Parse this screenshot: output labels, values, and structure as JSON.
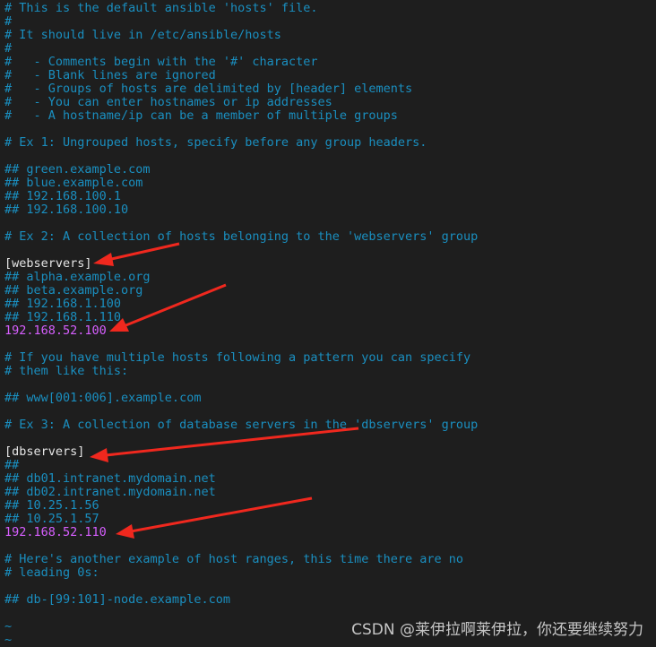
{
  "editor": {
    "lines": [
      {
        "text": "# This is the default ansible 'hosts' file.",
        "type": "comment"
      },
      {
        "text": "#",
        "type": "comment"
      },
      {
        "text": "# It should live in /etc/ansible/hosts",
        "type": "comment"
      },
      {
        "text": "#",
        "type": "comment"
      },
      {
        "text": "#   - Comments begin with the '#' character",
        "type": "comment"
      },
      {
        "text": "#   - Blank lines are ignored",
        "type": "comment"
      },
      {
        "text": "#   - Groups of hosts are delimited by [header] elements",
        "type": "comment"
      },
      {
        "text": "#   - You can enter hostnames or ip addresses",
        "type": "comment"
      },
      {
        "text": "#   - A hostname/ip can be a member of multiple groups",
        "type": "comment"
      },
      {
        "text": "",
        "type": "blank"
      },
      {
        "text": "# Ex 1: Ungrouped hosts, specify before any group headers.",
        "type": "comment"
      },
      {
        "text": "",
        "type": "blank"
      },
      {
        "text": "## green.example.com",
        "type": "comment"
      },
      {
        "text": "## blue.example.com",
        "type": "comment"
      },
      {
        "text": "## 192.168.100.1",
        "type": "comment"
      },
      {
        "text": "## 192.168.100.10",
        "type": "comment"
      },
      {
        "text": "",
        "type": "blank"
      },
      {
        "text": "# Ex 2: A collection of hosts belonging to the 'webservers' group",
        "type": "comment"
      },
      {
        "text": "",
        "type": "blank"
      },
      {
        "text": "[webservers]",
        "type": "header"
      },
      {
        "text": "## alpha.example.org",
        "type": "comment"
      },
      {
        "text": "## beta.example.org",
        "type": "comment"
      },
      {
        "text": "## 192.168.1.100",
        "type": "comment"
      },
      {
        "text": "## 192.168.1.110",
        "type": "comment"
      },
      {
        "text": "192.168.52.100",
        "type": "host"
      },
      {
        "text": "",
        "type": "blank"
      },
      {
        "text": "# If you have multiple hosts following a pattern you can specify",
        "type": "comment"
      },
      {
        "text": "# them like this:",
        "type": "comment"
      },
      {
        "text": "",
        "type": "blank"
      },
      {
        "text": "## www[001:006].example.com",
        "type": "comment"
      },
      {
        "text": "",
        "type": "blank"
      },
      {
        "text": "# Ex 3: A collection of database servers in the 'dbservers' group",
        "type": "comment"
      },
      {
        "text": "",
        "type": "blank"
      },
      {
        "text": "[dbservers]",
        "type": "header"
      },
      {
        "text": "##",
        "type": "comment"
      },
      {
        "text": "## db01.intranet.mydomain.net",
        "type": "comment"
      },
      {
        "text": "## db02.intranet.mydomain.net",
        "type": "comment"
      },
      {
        "text": "## 10.25.1.56",
        "type": "comment"
      },
      {
        "text": "## 10.25.1.57",
        "type": "comment"
      },
      {
        "text": "192.168.52.110",
        "type": "host"
      },
      {
        "text": "",
        "type": "blank"
      },
      {
        "text": "# Here's another example of host ranges, this time there are no",
        "type": "comment"
      },
      {
        "text": "# leading 0s:",
        "type": "comment"
      },
      {
        "text": "",
        "type": "blank"
      },
      {
        "text": "## db-[99:101]-node.example.com",
        "type": "comment"
      },
      {
        "text": "",
        "type": "blank"
      },
      {
        "text": "~",
        "type": "tilde"
      },
      {
        "text": "~",
        "type": "tilde"
      }
    ]
  },
  "colors": {
    "background": "#1e1e1e",
    "comment": "#1a8fc0",
    "header": "#e6e6e6",
    "host": "#d75fff",
    "annotation_arrow": "#f0281e"
  },
  "watermark": "CSDN @莱伊拉啊莱伊拉，你还要继续努力"
}
